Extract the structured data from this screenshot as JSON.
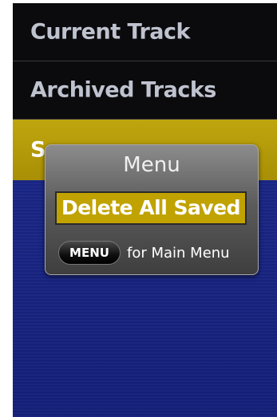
{
  "list": {
    "items": [
      {
        "label": "Current Track"
      },
      {
        "label": "Archived Tracks"
      },
      {
        "label": "S"
      }
    ]
  },
  "popup": {
    "title": "Menu",
    "option": "Delete All Saved",
    "key_label": "MENU",
    "hint": "for Main Menu"
  },
  "colors": {
    "background": "#1a2686",
    "list_bg": "#0b0b0d",
    "selection": "#bfa60e",
    "popup_option": "#c0a200"
  }
}
